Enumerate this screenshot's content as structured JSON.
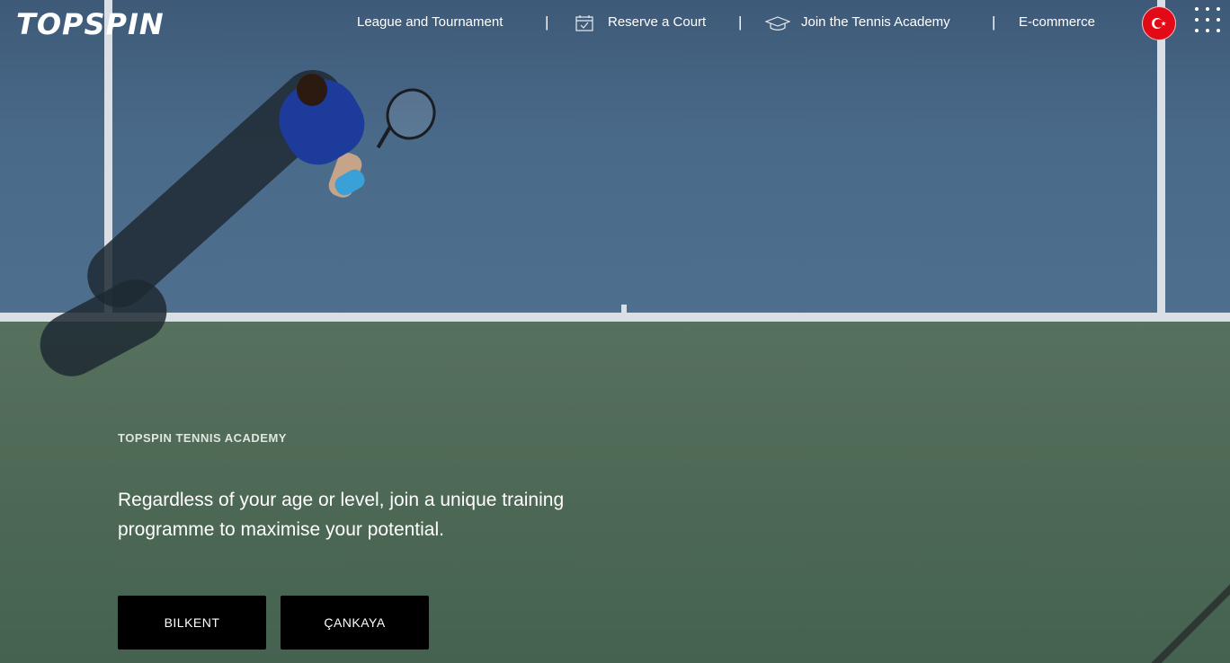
{
  "header": {
    "logo_text": "TOPSPIN",
    "nav": [
      {
        "label": "League and Tournament"
      },
      {
        "label": "Reserve a Court",
        "icon": "calendar-check-icon"
      },
      {
        "label": "Join the Tennis Academy",
        "icon": "graduation-cap-icon"
      },
      {
        "label": "E-commerce"
      }
    ],
    "separator": "|",
    "language_flag": "turkey-flag-icon",
    "menu_icon": "grid-menu-icon"
  },
  "hero": {
    "eyebrow": "TOPSPIN TENNIS ACADEMY",
    "lead": "Regardless of your age or level, join a unique training programme to maximise your potential.",
    "buttons": [
      {
        "label": "BILKENT"
      },
      {
        "label": "ÇANKAYA"
      }
    ]
  },
  "colors": {
    "court_blue": "#4a6a8a",
    "court_green": "#4f6a56",
    "button_bg": "#000000",
    "flag_red": "#e30a17"
  }
}
